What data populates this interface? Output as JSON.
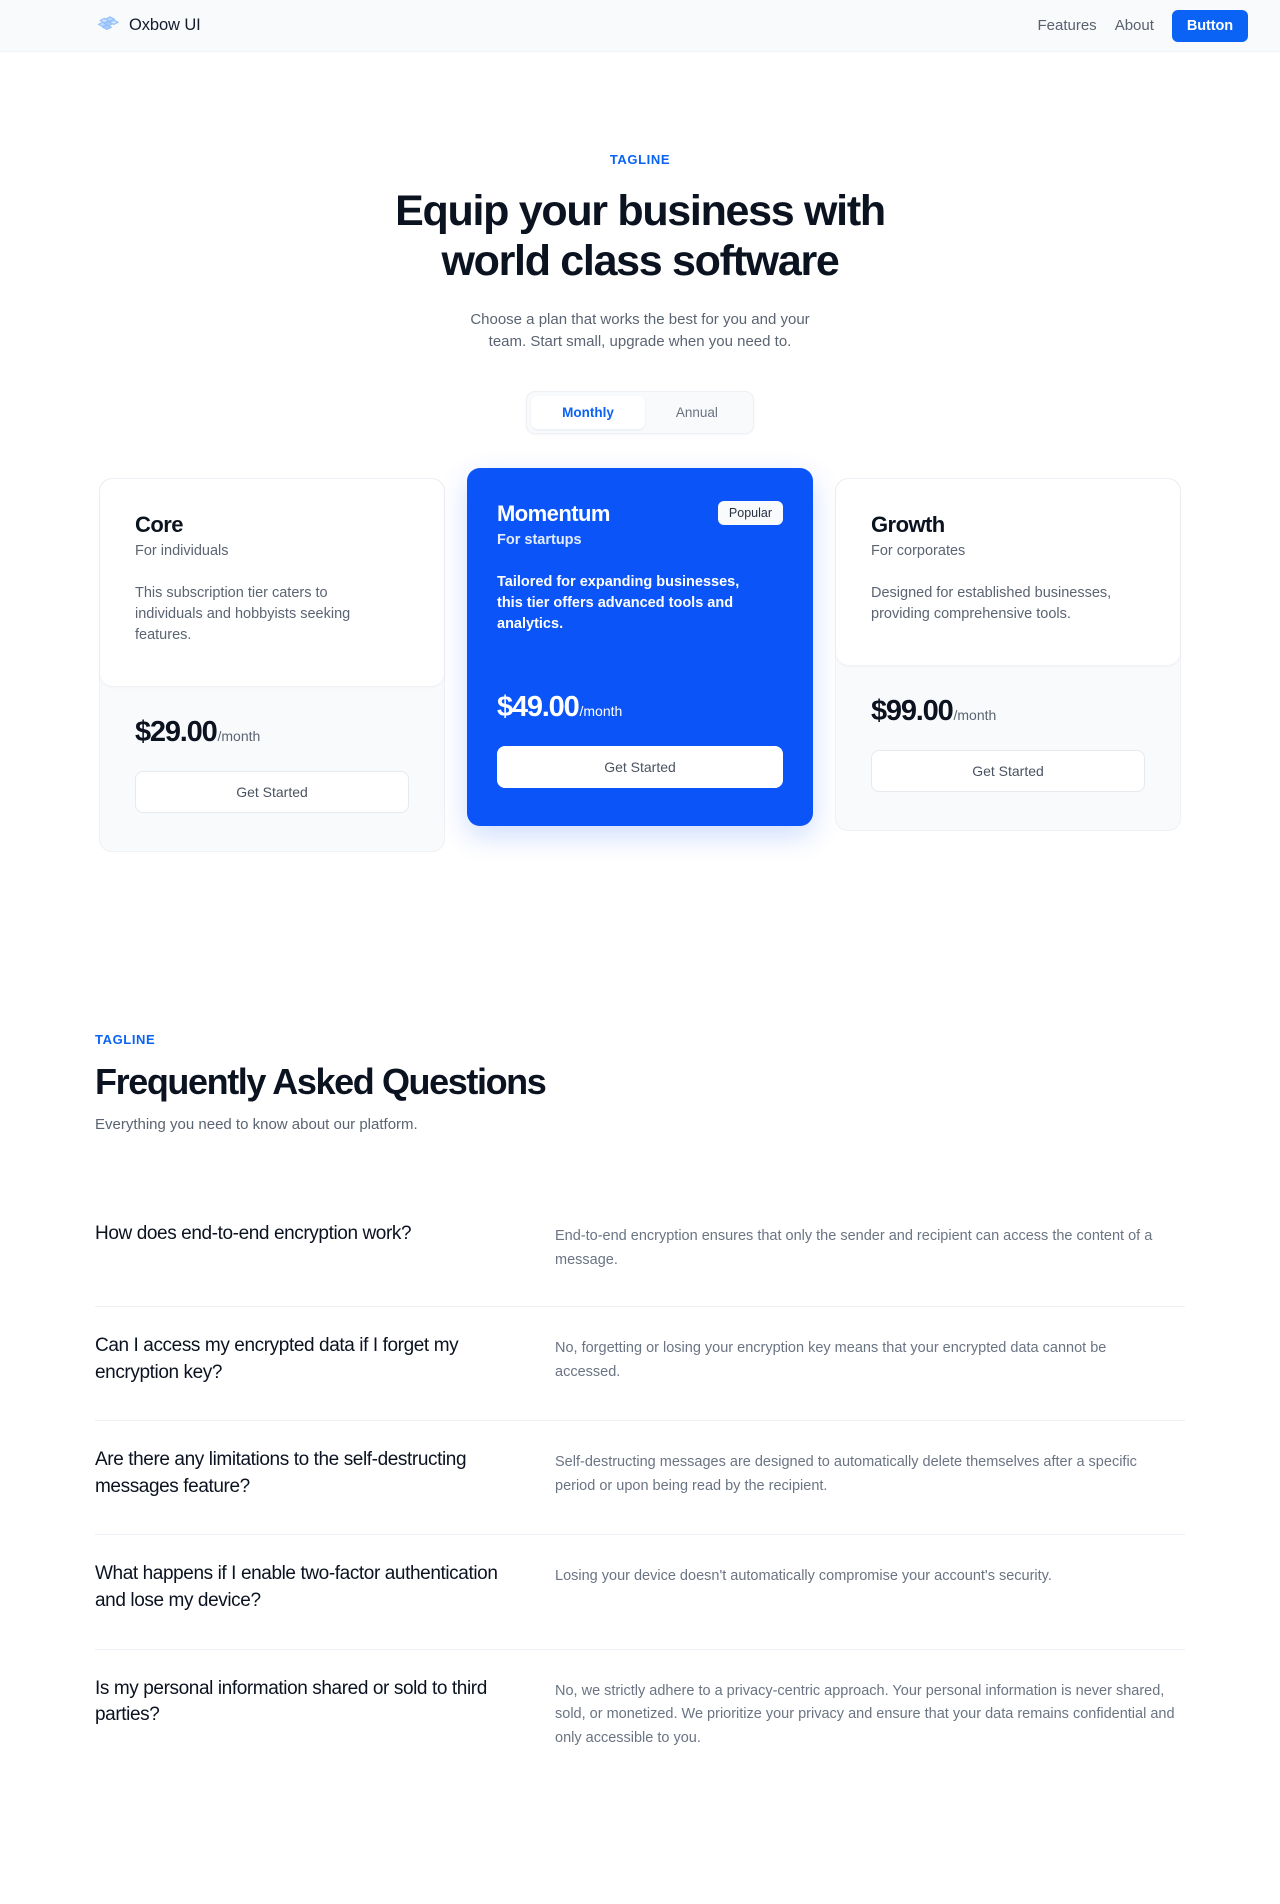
{
  "nav": {
    "brand": "Oxbow UI",
    "logo_icon": "cubes-logo-icon",
    "links": [
      {
        "label": "Features"
      },
      {
        "label": "About"
      }
    ],
    "button_label": "Button",
    "accent_color": "#0b63f6"
  },
  "hero": {
    "tagline": "TAGLINE",
    "title_line1": "Equip your business with",
    "title_line2": "world class software",
    "subtitle": "Choose a plan that works the best for you and your team. Start small, upgrade when you need to."
  },
  "billing_toggle": {
    "options": [
      {
        "label": "Monthly",
        "active": true
      },
      {
        "label": "Annual",
        "active": false
      }
    ],
    "selected": "Monthly"
  },
  "pricing": {
    "plans": [
      {
        "name": "Core",
        "audience": "For individuals",
        "description": "This subscription tier caters to individuals and hobbyists seeking features.",
        "price": "$29.00",
        "period": "/month",
        "cta": "Get Started",
        "badge": null,
        "featured": false
      },
      {
        "name": "Momentum",
        "audience": "For startups",
        "description": "Tailored for expanding businesses, this tier offers advanced tools and analytics.",
        "price": "$49.00",
        "period": "/month",
        "cta": "Get Started",
        "badge": "Popular",
        "featured": true
      },
      {
        "name": "Growth",
        "audience": "For corporates",
        "description": "Designed for established businesses, providing comprehensive tools.",
        "price": "$99.00",
        "period": "/month",
        "cta": "Get Started",
        "badge": null,
        "featured": false
      }
    ]
  },
  "faq": {
    "tagline": "TAGLINE",
    "title": "Frequently Asked Questions",
    "subtitle": "Everything you need to know about our platform.",
    "items": [
      {
        "question": "How does end-to-end encryption work?",
        "answer": "End-to-end encryption ensures that only the sender and recipient can access the content of a message."
      },
      {
        "question": "Can I access my encrypted data if I forget my encryption key?",
        "answer": "No, forgetting or losing your encryption key means that your encrypted data cannot be accessed."
      },
      {
        "question": "Are there any limitations to the self-destructing messages feature?",
        "answer": "Self-destructing messages are designed to automatically delete themselves after a specific period or upon being read by the recipient."
      },
      {
        "question": "What happens if I enable two-factor authentication and lose my device?",
        "answer": "Losing your device doesn't automatically compromise your account's security."
      },
      {
        "question": "Is my personal information shared or sold to third parties?",
        "answer": "No, we strictly adhere to a privacy-centric approach. Your personal information is never shared, sold, or monetized. We prioritize your privacy and ensure that your data remains confidential and only accessible to you."
      }
    ]
  }
}
